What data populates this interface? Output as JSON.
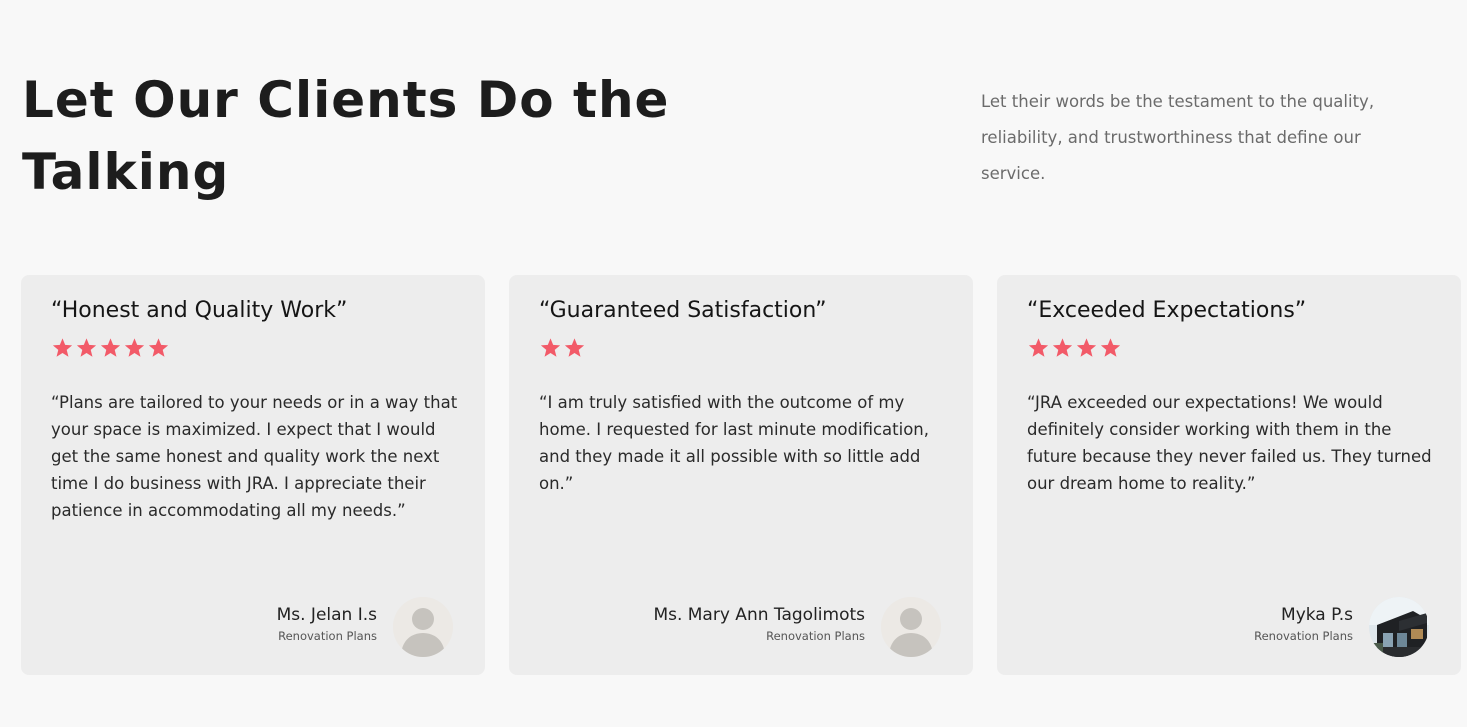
{
  "header": {
    "title": "Let Our Clients Do the Talking",
    "subtitle": "Let their words be the testament to the quality, reliability, and trustworthiness that define our service."
  },
  "colors": {
    "star": "#f25a68",
    "card_background": "#ededed",
    "page_background": "#f8f8f8"
  },
  "testimonials": [
    {
      "title": "“Honest and Quality Work”",
      "rating": 5,
      "quote": "“Plans are tailored to your needs or in a way that your space is maximized. I expect that I would get the same honest and quality work the next time I do business with JRA. I appreciate their patience in accommodating all my needs.”",
      "author": "Ms. Jelan I.s",
      "category": "Renovation Plans",
      "avatar_icon": "default-person-icon"
    },
    {
      "title": "“Guaranteed Satisfaction”",
      "rating": 2,
      "quote": "“I am truly satisfied with the outcome of my home. I requested for last minute modification, and they made it all possible with so little add on.”",
      "author": "Ms. Mary Ann Tagolimots",
      "category": "Renovation Plans",
      "avatar_icon": "default-person-icon"
    },
    {
      "title": "“Exceeded Expectations”",
      "rating": 4,
      "quote": "“JRA exceeded our expectations! We would definitely consider working with them in the future because they never failed us. They turned our dream home to reality.”",
      "author": "Myka P.s",
      "category": "Renovation Plans",
      "avatar_icon": "house-photo-icon"
    }
  ]
}
